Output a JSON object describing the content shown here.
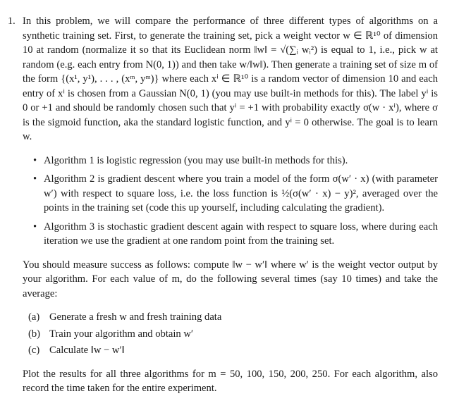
{
  "problem": {
    "number": "1.",
    "intro": "In this problem, we will compare the performance of three different types of algorithms on a synthetic training set. First, to generate the training set, pick a weight vector w ∈ ℝ¹⁰ of dimension 10 at random (normalize it so that its Euclidean norm ‖w‖ = √(∑ᵢ wᵢ²) is equal to 1, i.e., pick w at random (e.g. each entry from N(0, 1)) and then take w/‖w‖). Then generate a training set of size m of the form {(x¹, y¹), . . . , (xᵐ, yᵐ)} where each xⁱ ∈ ℝ¹⁰ is a random vector of dimension 10 and each entry of xⁱ is chosen from a Gaussian N(0, 1) (you may use built-in methods for this). The label yⁱ is 0 or +1 and should be randomly chosen such that yⁱ = +1 with probability exactly σ(w · xⁱ), where σ is the sigmoid function, aka the standard logistic function, and yⁱ = 0 otherwise. The goal is to learn w.",
    "bullet_glyph": "•",
    "algorithms": [
      "Algorithm 1 is logistic regression (you may use built-in methods for this).",
      "Algorithm 2 is gradient descent where you train a model of the form σ(w′ · x) (with parameter w′) with respect to square loss, i.e. the loss function is ½(σ(w′ · x) − y)², averaged over the points in the training set (code this up yourself, including calculating the gradient).",
      "Algorithm 3 is stochastic gradient descent again with respect to square loss, where during each iteration we use the gradient at one random point from the training set."
    ],
    "measure": "You should measure success as follows: compute ‖w − w′‖ where w′ is the weight vector output by your algorithm. For each value of m, do the following several times (say 10 times) and take the average:",
    "steps": [
      {
        "label": "(a)",
        "text": "Generate a fresh w and fresh training data"
      },
      {
        "label": "(b)",
        "text": "Train your algorithm and obtain w′"
      },
      {
        "label": "(c)",
        "text": "Calculate ‖w − w′‖"
      }
    ],
    "conclusion": "Plot the results for all three algorithms for m = 50, 100, 150, 200, 250. For each algorithm, also record the time taken for the entire experiment."
  }
}
